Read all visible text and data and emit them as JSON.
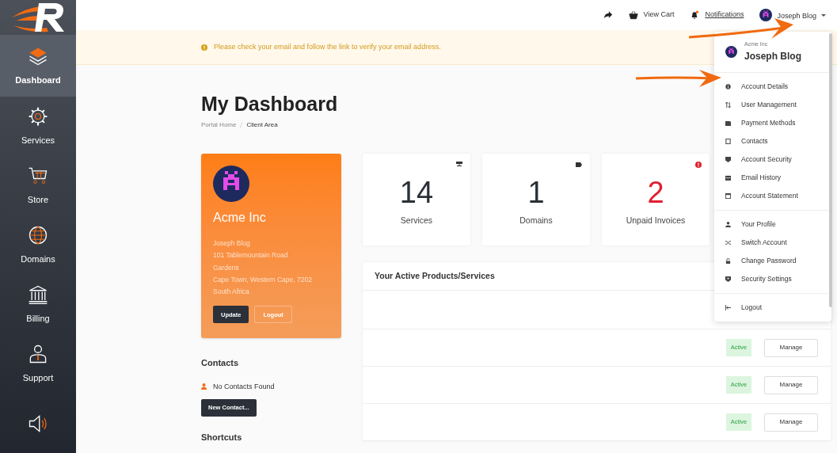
{
  "sidebar": {
    "items": [
      {
        "label": "Dashboard",
        "selected": true
      },
      {
        "label": "Services",
        "selected": false
      },
      {
        "label": "Store",
        "selected": false
      },
      {
        "label": "Domains",
        "selected": false
      },
      {
        "label": "Billing",
        "selected": false
      },
      {
        "label": "Support",
        "selected": false
      },
      {
        "selected": false
      }
    ]
  },
  "header": {
    "links": [
      {
        "kind": "share"
      },
      {
        "kind": "cart",
        "label": "View Cart"
      },
      {
        "kind": "notifications",
        "label": "Notifications"
      }
    ],
    "user": "Joseph Blog"
  },
  "alert": "Please check your email and follow the link to verify your email address.",
  "page_title": "My Dashboard",
  "breadcrumb": [
    {
      "label": "Portal Home",
      "selected": false
    },
    {
      "label": "Client Area",
      "selected": true
    }
  ],
  "profile_card": {
    "company": "Acme Inc",
    "address_lines": [
      "Joseph Blog",
      "101 Tablemountain Road",
      "Gardens",
      "Cape Town, Western Cape, 7202",
      "South Africa"
    ],
    "buttons": [
      {
        "label": "Update",
        "kind": "primary"
      },
      {
        "label": "Logout",
        "kind": "outline"
      }
    ]
  },
  "contacts": {
    "title": "Contacts",
    "empty_text": "No Contacts Found",
    "button": "New Contact..."
  },
  "shortcuts": {
    "title": "Shortcuts"
  },
  "stats": [
    {
      "value": "14",
      "label": "Services",
      "alert": false
    },
    {
      "value": "1",
      "label": "Domains",
      "alert": false
    },
    {
      "value": "2",
      "label": "Unpaid Invoices",
      "alert": true
    }
  ],
  "products": {
    "title": "Your Active Products/Services",
    "rows": [
      {
        "kind": "covered"
      },
      {
        "kind": "row",
        "status": "Active",
        "action": "Manage"
      },
      {
        "kind": "row",
        "status": "Active",
        "action": "Manage"
      },
      {
        "kind": "row",
        "status": "Active",
        "action": "Manage"
      }
    ]
  },
  "dropdown": {
    "company": "Acme Inc",
    "user": "Joseph Blog",
    "groups": [
      [
        "Account Details",
        "User Management",
        "Payment Methods",
        "Contacts",
        "Account Security",
        "Email History",
        "Account Statement"
      ],
      [
        "Your Profile",
        "Switch Account",
        "Change Password",
        "Security Settings"
      ],
      [
        "Logout"
      ]
    ]
  }
}
